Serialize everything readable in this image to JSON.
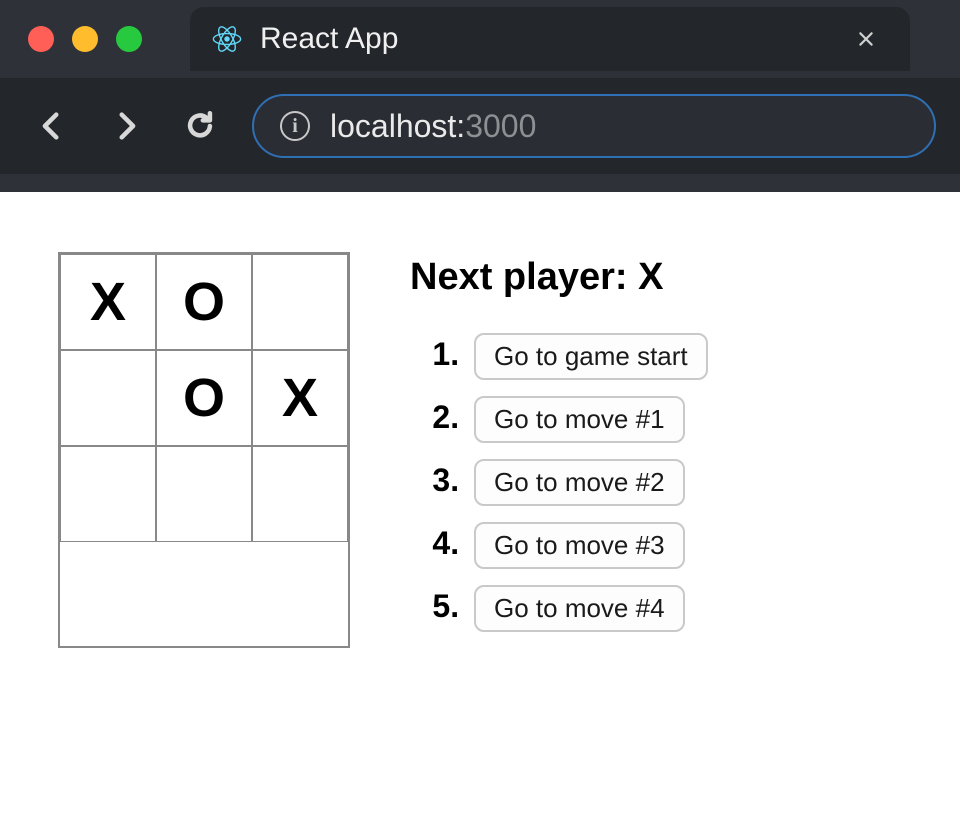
{
  "browser": {
    "tab_title": "React App",
    "url_host": "localhost:",
    "url_port": "3000"
  },
  "game": {
    "status": "Next player: X",
    "board": [
      "X",
      "O",
      "",
      "",
      "O",
      "X",
      "",
      "",
      ""
    ],
    "moves": [
      {
        "num": "1.",
        "label": "Go to game start"
      },
      {
        "num": "2.",
        "label": "Go to move #1"
      },
      {
        "num": "3.",
        "label": "Go to move #2"
      },
      {
        "num": "4.",
        "label": "Go to move #3"
      },
      {
        "num": "5.",
        "label": "Go to move #4"
      }
    ]
  }
}
